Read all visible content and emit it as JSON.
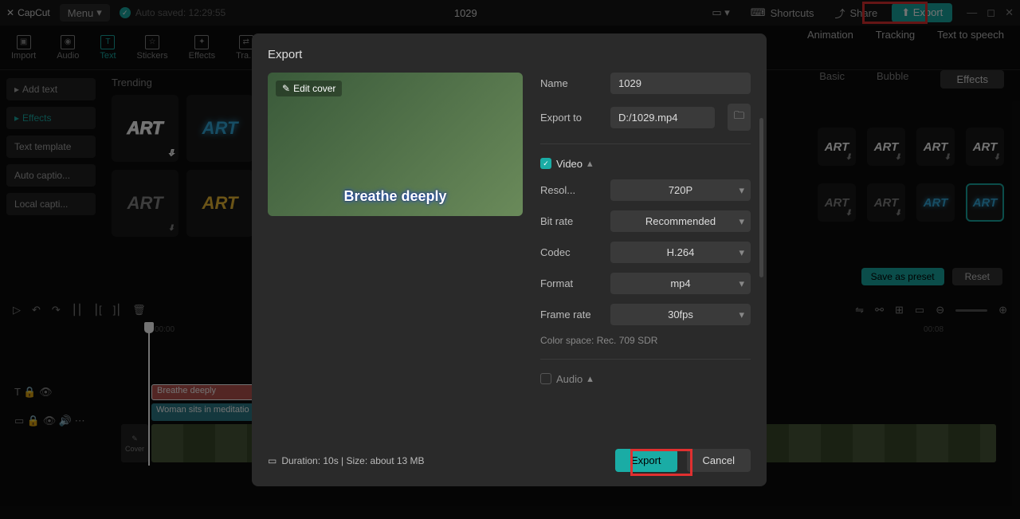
{
  "app": {
    "name": "CapCut",
    "menu": "Menu",
    "autosaved": "Auto saved: 12:29:55",
    "project": "1029",
    "shortcuts": "Shortcuts",
    "share": "Share",
    "export": "Export"
  },
  "mediaTabs": [
    "Import",
    "Audio",
    "Text",
    "Stickers",
    "Effects",
    "Tra..."
  ],
  "sidebar": {
    "items": [
      "Add text",
      "Effects",
      "Text template",
      "Auto captio...",
      "Local capti..."
    ]
  },
  "gallery": {
    "trending": "Trending"
  },
  "rightTabs": [
    "Animation",
    "Tracking",
    "Text to speech"
  ],
  "rightSub": [
    "Basic",
    "Bubble",
    "Effects"
  ],
  "rightActions": {
    "save": "Save as preset",
    "reset": "Reset"
  },
  "timeline": {
    "marks": [
      "00:00",
      "00:08"
    ],
    "track1": "Breathe deeply",
    "track2": "Woman sits in meditatio",
    "cover": "Cover"
  },
  "modal": {
    "title": "Export",
    "editCover": "Edit cover",
    "previewCaption": "Breathe deeply",
    "name": {
      "label": "Name",
      "value": "1029"
    },
    "exportTo": {
      "label": "Export to",
      "value": "D:/1029.mp4"
    },
    "video": "Video",
    "resolution": {
      "label": "Resol...",
      "value": "720P"
    },
    "bitrate": {
      "label": "Bit rate",
      "value": "Recommended"
    },
    "codec": {
      "label": "Codec",
      "value": "H.264"
    },
    "format": {
      "label": "Format",
      "value": "mp4"
    },
    "framerate": {
      "label": "Frame rate",
      "value": "30fps"
    },
    "colorspace": "Color space: Rec. 709 SDR",
    "audio": "Audio",
    "duration": "Duration: 10s | Size: about 13 MB",
    "exportBtn": "Export",
    "cancelBtn": "Cancel"
  }
}
